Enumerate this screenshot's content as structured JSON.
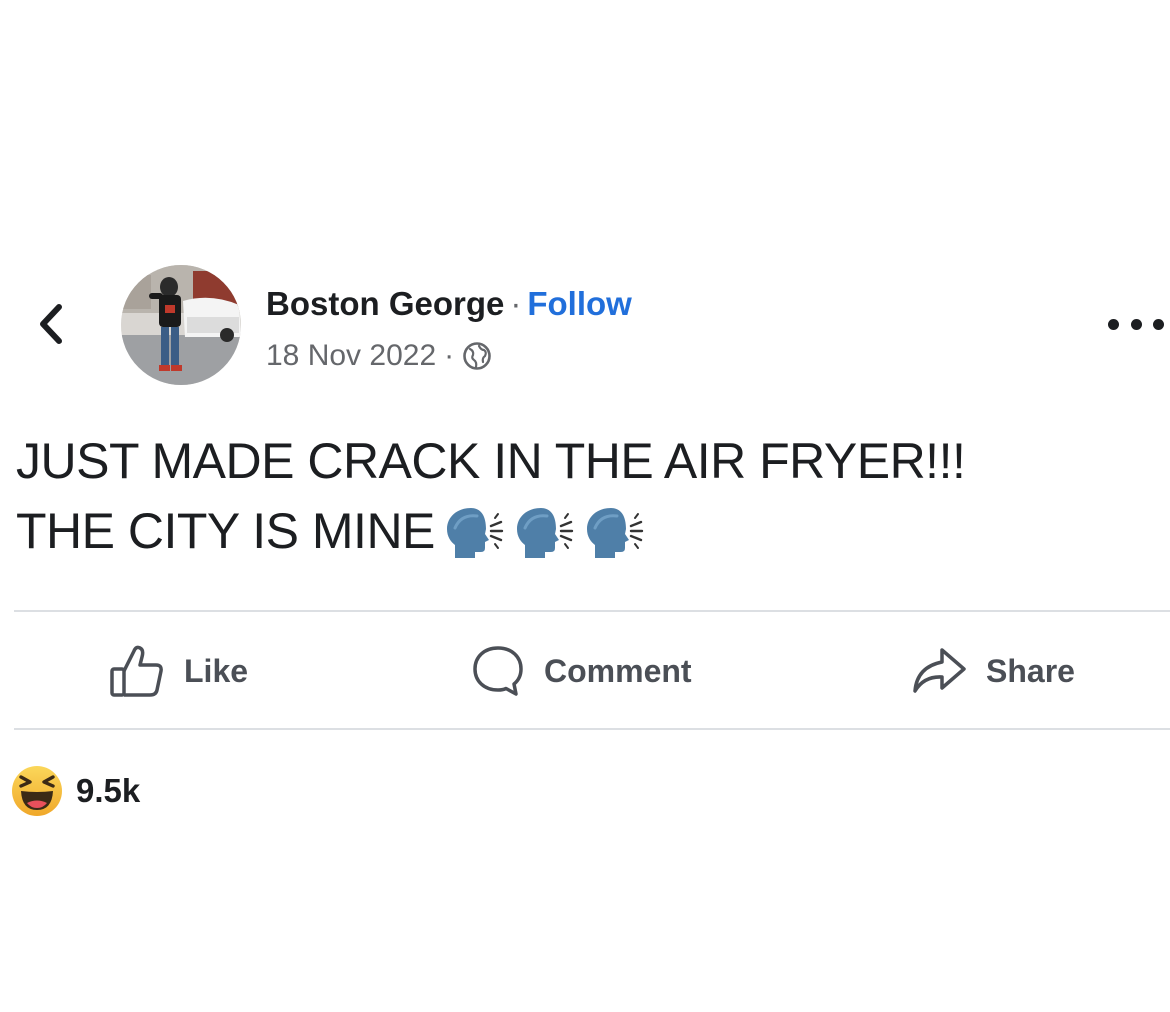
{
  "header": {
    "back_icon": "chevron-left-icon",
    "author_name": "Boston George",
    "separator": "·",
    "follow_label": "Follow",
    "date": "18 Nov 2022",
    "audience_icon": "globe-icon",
    "more_icon": "more-horizontal-icon"
  },
  "post": {
    "line1": "JUST MADE CRACK IN THE AIR FRYER!!!",
    "line2": "THE CITY IS MINE",
    "emoji": "speaking-head-emoji",
    "emoji_count": 3
  },
  "actions": {
    "like_label": "Like",
    "comment_label": "Comment",
    "share_label": "Share"
  },
  "reactions": {
    "icon": "laughing-face-icon",
    "count": "9.5k"
  },
  "colors": {
    "follow": "#216fdb",
    "text": "#1c1e21",
    "secondary": "#65676b",
    "action": "#4b4f56",
    "divider": "#dcdfe3",
    "emoji_blue": "#4f7fa8",
    "laugh_yellow": "#f7c33c"
  }
}
